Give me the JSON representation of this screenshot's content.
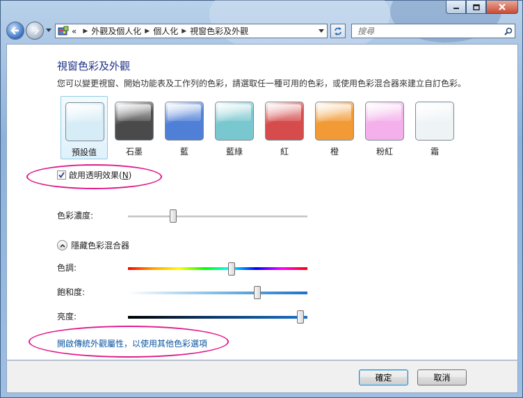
{
  "window": {
    "caption": {
      "minimize_icon": "minimize-icon",
      "maximize_icon": "maximize-icon",
      "close_icon": "close-icon"
    }
  },
  "address": {
    "overflow": "«",
    "crumbs": [
      "外觀及個人化",
      "個人化",
      "視窗色彩及外觀"
    ],
    "search_placeholder": "搜尋"
  },
  "page": {
    "title": "視窗色彩及外觀",
    "description": "您可以變更視窗、開始功能表及工作列的色彩，請選取任一種可用的色彩，或使用色彩混合器來建立自訂色彩。",
    "swatches": [
      {
        "label": "預設值",
        "color": "#d6ecf7",
        "selected": true
      },
      {
        "label": "石墨",
        "color": "#4a4a4a",
        "selected": false
      },
      {
        "label": "藍",
        "color": "#4f7fd6",
        "selected": false
      },
      {
        "label": "藍綠",
        "color": "#79c7cf",
        "selected": false
      },
      {
        "label": "紅",
        "color": "#d64c4c",
        "selected": false
      },
      {
        "label": "橙",
        "color": "#f29a35",
        "selected": false
      },
      {
        "label": "粉紅",
        "color": "#f3b0ea",
        "selected": false
      },
      {
        "label": "霜",
        "color": "#eef3f6",
        "selected": false
      }
    ],
    "transparency": {
      "label": "啟用透明效果(",
      "accel": "N",
      "label_end": ")",
      "checked": true
    },
    "intensity": {
      "label": "色彩濃度:",
      "value": 0.24
    },
    "mixer": {
      "toggle_label": "隱藏色彩混合器",
      "hue": {
        "label": "色調:",
        "value": 0.58
      },
      "saturation": {
        "label": "飽和度:",
        "value": 0.73
      },
      "brightness": {
        "label": "亮度:",
        "value": 0.98
      }
    },
    "advanced_link": "開啟傳統外觀屬性，以使用其他色彩選項"
  },
  "footer": {
    "ok_label": "確定",
    "cancel_label": "取消"
  },
  "colors": {
    "title_blue": "#1e3287",
    "link_blue": "#0b56a3",
    "annotation_pink": "#e0198a"
  }
}
